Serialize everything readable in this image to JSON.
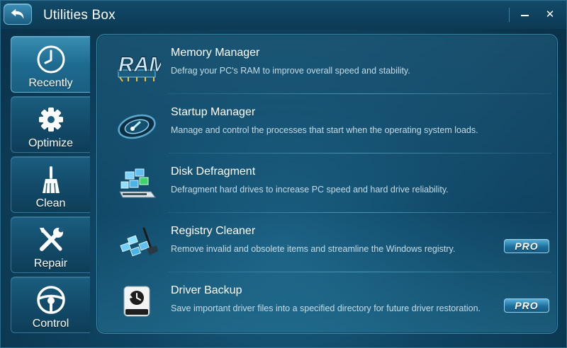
{
  "window": {
    "title": "Utilities Box"
  },
  "titlebar": {
    "back_icon": "back-arrow-icon",
    "minimize_icon": "minimize-icon",
    "close_label": "✕"
  },
  "sidebar": {
    "items": [
      {
        "label": "Recently",
        "icon": "clock-icon",
        "active": true
      },
      {
        "label": "Optimize",
        "icon": "gear-icon",
        "active": false
      },
      {
        "label": "Clean",
        "icon": "broom-icon",
        "active": false
      },
      {
        "label": "Repair",
        "icon": "wrench-screwdriver-icon",
        "active": false
      },
      {
        "label": "Control",
        "icon": "steering-wheel-icon",
        "active": false
      }
    ]
  },
  "utilities": [
    {
      "name": "Memory Manager",
      "description": "Defrag your PC's RAM to improve overall speed and stability.",
      "icon": "ram-icon",
      "pro": false,
      "icon_text": "RAM"
    },
    {
      "name": "Startup Manager",
      "description": "Manage and control the processes that start when the operating system loads.",
      "icon": "startup-gauge-icon",
      "pro": false
    },
    {
      "name": "Disk Defragment",
      "description": "Defragment hard drives to increase PC speed and hard drive reliability.",
      "icon": "disk-defrag-icon",
      "pro": false
    },
    {
      "name": "Registry Cleaner",
      "description": "Remove invalid and obsolete items and streamline the Windows registry.",
      "icon": "registry-cleaner-icon",
      "pro": true,
      "badge": "PRO"
    },
    {
      "name": "Driver Backup",
      "description": "Save important driver files into a specified directory for future driver restoration.",
      "icon": "driver-backup-icon",
      "pro": true,
      "badge": "PRO"
    }
  ],
  "colors": {
    "background": "#0f4563",
    "accent": "#3a8db2",
    "badge": "#1d6f9c"
  }
}
